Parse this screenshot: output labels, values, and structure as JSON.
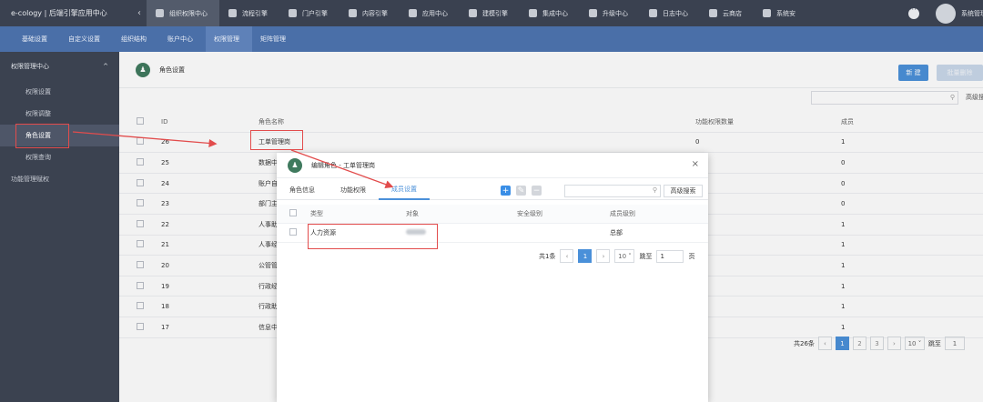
{
  "topbar": {
    "brand": "e-cology | 后端引擎应用中心",
    "collapse_glyph": "‹",
    "tabs": [
      {
        "label": "组织权限中心",
        "icon": "shield-icon"
      },
      {
        "label": "流程引擎",
        "icon": "flow-icon"
      },
      {
        "label": "门户引擎",
        "icon": "portal-icon"
      },
      {
        "label": "内容引擎",
        "icon": "content-icon"
      },
      {
        "label": "应用中心",
        "icon": "apps-icon"
      },
      {
        "label": "建模引擎",
        "icon": "model-icon"
      },
      {
        "label": "集成中心",
        "icon": "integration-icon"
      },
      {
        "label": "升级中心",
        "icon": "upgrade-icon"
      },
      {
        "label": "日志中心",
        "icon": "log-icon"
      },
      {
        "label": "云商店",
        "icon": "store-icon"
      },
      {
        "label": "系统安",
        "icon": "security-icon"
      }
    ],
    "user_name": "系统管理"
  },
  "subbar": {
    "tabs": [
      "基础设置",
      "自定义设置",
      "组织结构",
      "账户中心",
      "权限管理",
      "矩阵管理"
    ]
  },
  "sidebar": {
    "group_title": "权限管理中心",
    "group_toggle": "^",
    "items": [
      "权限设置",
      "权限调整",
      "角色设置",
      "权限查询"
    ],
    "bottom_item": "功能管理赋权"
  },
  "page": {
    "title": "角色设置",
    "title_icon_glyph": "♟",
    "new_button": "新 建",
    "batch_delete_button": "批量删除",
    "search_icon_glyph": "⚲",
    "advanced_search": "高级搜",
    "columns": [
      "ID",
      "角色名称",
      "功能权限数量",
      "成员"
    ],
    "rows": [
      {
        "id": "26",
        "name": "工单管理岗",
        "func": "0",
        "members": "1"
      },
      {
        "id": "25",
        "name": "数据中",
        "func": "",
        "members": "0"
      },
      {
        "id": "24",
        "name": "账户自",
        "func": "",
        "members": "0"
      },
      {
        "id": "23",
        "name": "部门主",
        "func": "",
        "members": "0"
      },
      {
        "id": "22",
        "name": "人事助",
        "func": "",
        "members": "1"
      },
      {
        "id": "21",
        "name": "人事经",
        "func": "",
        "members": "1"
      },
      {
        "id": "20",
        "name": "公管管",
        "func": "",
        "members": "1"
      },
      {
        "id": "19",
        "name": "行政经",
        "func": "",
        "members": "1"
      },
      {
        "id": "18",
        "name": "行政助",
        "func": "",
        "members": "1"
      },
      {
        "id": "17",
        "name": "信息中",
        "func": "",
        "members": "1"
      }
    ],
    "pager": {
      "total": "共26条",
      "prev": "‹",
      "pages": [
        "1",
        "2",
        "3"
      ],
      "next": "›",
      "page_size": "10",
      "jump_label": "跳至",
      "jump_value": "1"
    }
  },
  "modal": {
    "title": "编辑角色 - 工单管理岗",
    "close_glyph": "×",
    "tabs": [
      "角色信息",
      "功能权限",
      "成员设置"
    ],
    "active_tab": "成员设置",
    "tools": {
      "add": "+",
      "edit": "✎",
      "remove": "−"
    },
    "search_icon_glyph": "⚲",
    "advanced_search": "高级搜索",
    "columns": [
      "类型",
      "对象",
      "安全级别",
      "成员级别"
    ],
    "rows": [
      {
        "type": "人力资源",
        "object": "",
        "security": "",
        "level": "总部"
      }
    ],
    "pager": {
      "total": "共1条",
      "prev": "‹",
      "page": "1",
      "next": "›",
      "page_size": "10",
      "jump_label": "跳至",
      "jump_value": "1",
      "page_unit": "页"
    }
  },
  "colors": {
    "topbar": "#3a4150",
    "subbar": "#4a6fa8",
    "accent": "#4a90d9",
    "annotation": "#e24c4c"
  }
}
